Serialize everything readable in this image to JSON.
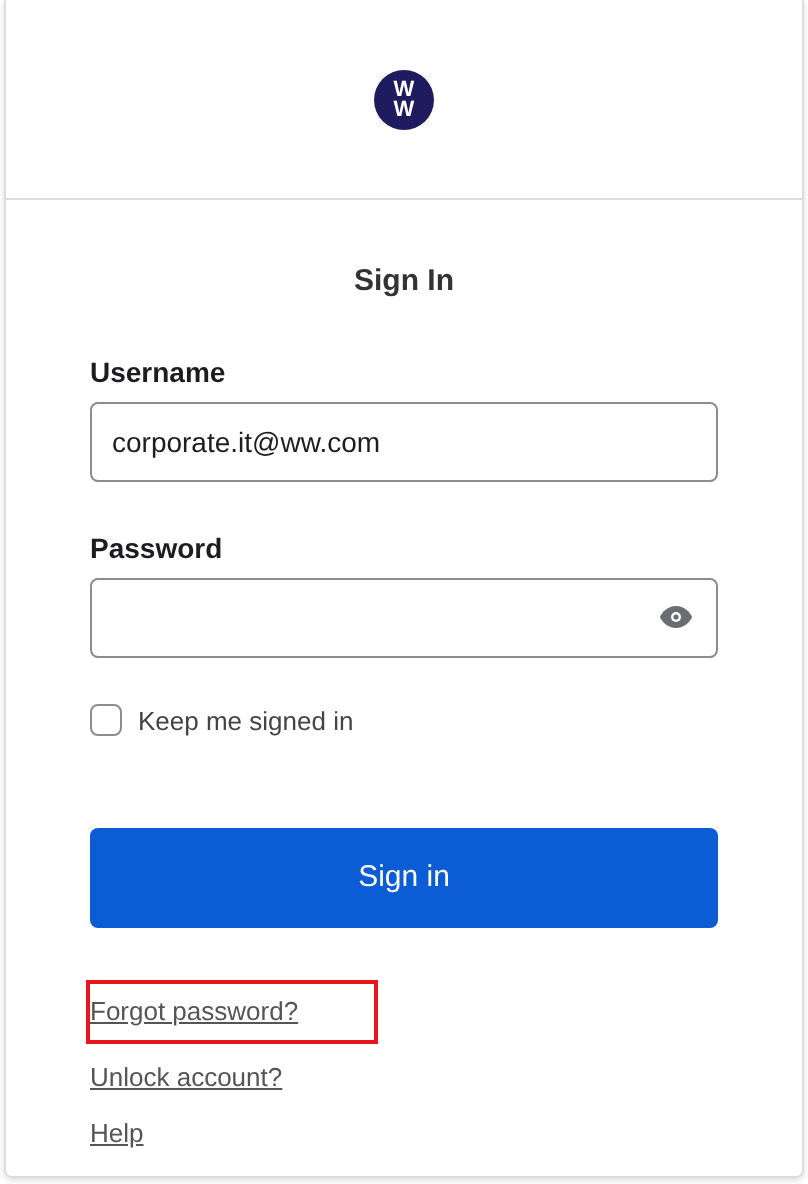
{
  "logo": {
    "letters": [
      "W",
      "W"
    ]
  },
  "title": "Sign In",
  "fields": [
    {
      "label": "Username",
      "value": "corporate.it@ww.com",
      "kind": "text"
    },
    {
      "label": "Password",
      "kind": "password"
    }
  ],
  "remember": {
    "label": "Keep me signed in",
    "checked": false
  },
  "submit": "Sign in",
  "links": [
    {
      "label": "Forgot password?",
      "highlighted": true
    },
    {
      "label": "Unlock account?",
      "highlighted": false
    },
    {
      "label": "Help",
      "highlighted": false
    }
  ]
}
